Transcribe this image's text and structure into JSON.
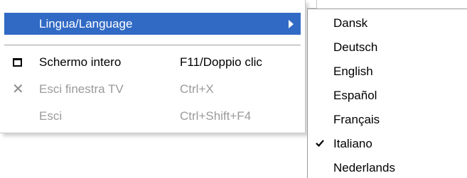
{
  "main_menu": {
    "language_item": {
      "label": "Lingua/Language"
    },
    "fullscreen_item": {
      "label": "Schermo intero",
      "shortcut": "F11/Doppio clic"
    },
    "close_tv_item": {
      "label": "Esci finestra TV",
      "shortcut": "Ctrl+X"
    },
    "exit_item": {
      "label": "Esci",
      "shortcut": "Ctrl+Shift+F4"
    }
  },
  "language_submenu": {
    "items": [
      {
        "label": "Dansk",
        "checked": false
      },
      {
        "label": "Deutsch",
        "checked": false
      },
      {
        "label": "English",
        "checked": false
      },
      {
        "label": "Español",
        "checked": false
      },
      {
        "label": "Français",
        "checked": false
      },
      {
        "label": "Italiano",
        "checked": true
      },
      {
        "label": "Nederlands",
        "checked": false
      }
    ]
  },
  "colors": {
    "highlight": "#316ac5",
    "disabled_text": "#9a9a9a"
  },
  "icons": {
    "submenu_arrow": "triangle-right",
    "fullscreen": "window-square",
    "close_tv": "cross",
    "selected_language": "checkmark"
  }
}
